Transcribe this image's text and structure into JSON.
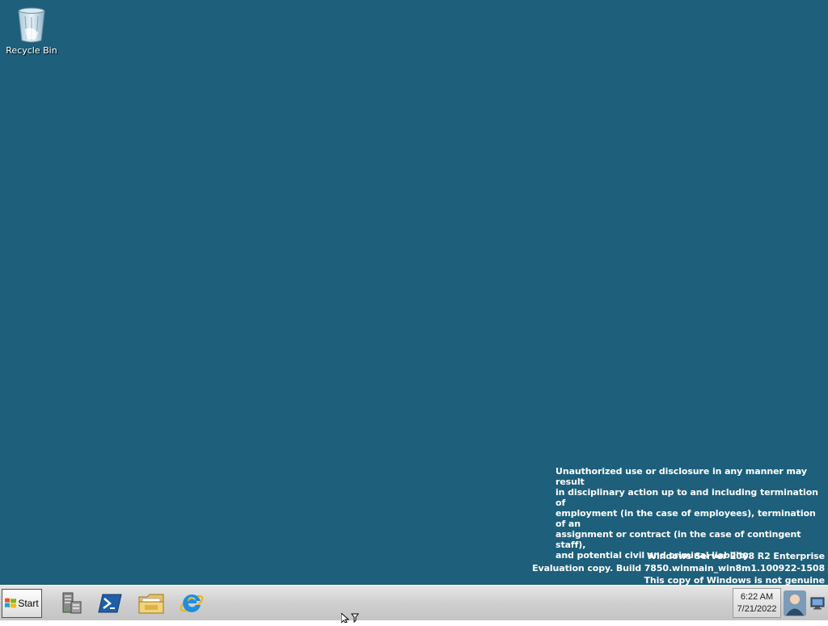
{
  "desktop": {
    "background": "#1e5f7b",
    "icons": [
      {
        "label": "Recycle Bin",
        "icon": "recycle-bin-icon"
      }
    ],
    "notice_lines": [
      "Unauthorized use or disclosure in any manner may result",
      "in disciplinary action up to and including termination of",
      "employment (in the case of employees), termination of an",
      "assignment or contract (in the case of contingent staff),",
      "and potential civil and criminal liability."
    ],
    "watermark": {
      "edition": "Windows Server 2008 R2 Enterprise",
      "build": "Evaluation copy. Build 7850.winmain_win8m1.100922-1508",
      "genuine": "This copy of Windows is not genuine"
    }
  },
  "taskbar": {
    "start_label": "Start",
    "pinned": [
      {
        "name": "server-manager-icon"
      },
      {
        "name": "powershell-icon"
      },
      {
        "name": "explorer-folder-icon"
      },
      {
        "name": "internet-explorer-icon"
      }
    ],
    "clock": {
      "time": "6:22 AM",
      "date": "7/21/2022"
    },
    "tray": [
      "user-icon",
      "show-desktop-icon"
    ]
  }
}
